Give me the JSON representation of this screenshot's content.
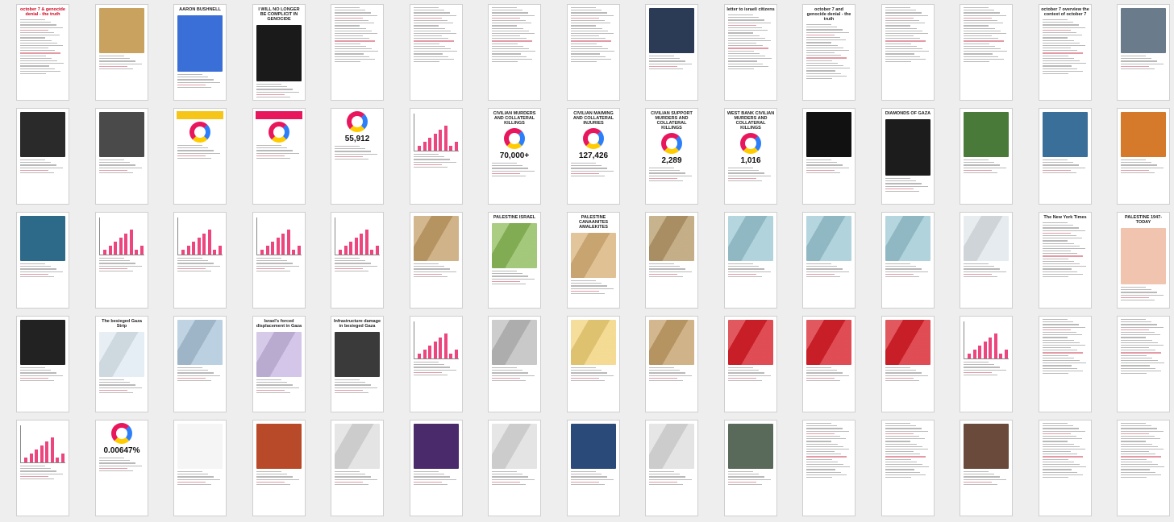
{
  "pages": [
    {
      "row": 0,
      "col": 0,
      "title": "october 7 & genocide denial - the truth",
      "title_color": "red",
      "kind": "text"
    },
    {
      "row": 0,
      "col": 1,
      "kind": "photo",
      "bg": "#c9a25f"
    },
    {
      "row": 0,
      "col": 2,
      "title": "AARON BUSHNELL",
      "kind": "poster",
      "bg": "#3a6fd8"
    },
    {
      "row": 0,
      "col": 3,
      "title": "I WILL NO LONGER BE COMPLICIT IN GENOCIDE",
      "kind": "poster",
      "bg": "#1a1a1a"
    },
    {
      "row": 0,
      "col": 4,
      "kind": "text"
    },
    {
      "row": 0,
      "col": 5,
      "kind": "text"
    },
    {
      "row": 0,
      "col": 6,
      "kind": "text"
    },
    {
      "row": 0,
      "col": 7,
      "kind": "text"
    },
    {
      "row": 0,
      "col": 8,
      "kind": "photo",
      "bg": "#2b3a55"
    },
    {
      "row": 0,
      "col": 9,
      "title": "letter to israeli citizens",
      "kind": "text"
    },
    {
      "row": 0,
      "col": 10,
      "title": "october 7 and genocide denial - the truth",
      "kind": "text"
    },
    {
      "row": 0,
      "col": 11,
      "kind": "text"
    },
    {
      "row": 0,
      "col": 12,
      "kind": "text"
    },
    {
      "row": 0,
      "col": 13,
      "title": "october 7 overview the context of october 7",
      "kind": "text"
    },
    {
      "row": 0,
      "col": 14,
      "kind": "photo",
      "bg": "#6a7b8c"
    },
    {
      "row": 1,
      "col": 0,
      "kind": "photo",
      "bg": "#2a2a2a"
    },
    {
      "row": 1,
      "col": 1,
      "kind": "photo",
      "bg": "#4a4a4a"
    },
    {
      "row": 1,
      "col": 2,
      "kind": "stats",
      "bg": "#f5c518"
    },
    {
      "row": 1,
      "col": 3,
      "kind": "stats",
      "bg": "#e8175d"
    },
    {
      "row": 1,
      "col": 4,
      "kind": "stats",
      "label": "55,912"
    },
    {
      "row": 1,
      "col": 5,
      "kind": "chart"
    },
    {
      "row": 1,
      "col": 6,
      "title": "CIVILIAN MURDERS AND COLLATERAL KILLINGS",
      "label": "70,000+",
      "kind": "stats"
    },
    {
      "row": 1,
      "col": 7,
      "title": "CIVILIAN MAIMING AND COLLATERAL INJURIES",
      "label": "127,426",
      "kind": "stats"
    },
    {
      "row": 1,
      "col": 8,
      "title": "CIVILIAN SUPPORT MURDERS AND COLLATERAL KILLINGS",
      "label": "2,289",
      "kind": "stats"
    },
    {
      "row": 1,
      "col": 9,
      "title": "WEST BANK CIVILIAN MURDERS AND COLLATERAL KILLINGS",
      "label": "1,016",
      "kind": "stats"
    },
    {
      "row": 1,
      "col": 10,
      "kind": "photo",
      "bg": "#111111"
    },
    {
      "row": 1,
      "col": 11,
      "title": "DIAMONDS OF GAZA",
      "kind": "poster",
      "bg": "#1c1c1c"
    },
    {
      "row": 1,
      "col": 12,
      "kind": "photo",
      "bg": "#4a7a3a"
    },
    {
      "row": 1,
      "col": 13,
      "kind": "photo",
      "bg": "#3a6f9a"
    },
    {
      "row": 1,
      "col": 14,
      "kind": "photo",
      "bg": "#d47a2a"
    },
    {
      "row": 2,
      "col": 0,
      "kind": "photo",
      "bg": "#2d6a8a"
    },
    {
      "row": 2,
      "col": 1,
      "kind": "chart"
    },
    {
      "row": 2,
      "col": 2,
      "kind": "chart"
    },
    {
      "row": 2,
      "col": 3,
      "kind": "chart"
    },
    {
      "row": 2,
      "col": 4,
      "kind": "chart"
    },
    {
      "row": 2,
      "col": 5,
      "kind": "map",
      "bg": "#c4a06a"
    },
    {
      "row": 2,
      "col": 6,
      "title": "PALESTINE ISRAEL",
      "kind": "map",
      "bg": "#8dbb5a"
    },
    {
      "row": 2,
      "col": 7,
      "title": "PALESTINE CANAANITES AMALEKITES",
      "kind": "map",
      "bg": "#d8b27a"
    },
    {
      "row": 2,
      "col": 8,
      "kind": "map",
      "bg": "#b69a6a"
    },
    {
      "row": 2,
      "col": 9,
      "kind": "map",
      "bg": "#9cc8d4"
    },
    {
      "row": 2,
      "col": 10,
      "kind": "map",
      "bg": "#9cc8d4"
    },
    {
      "row": 2,
      "col": 11,
      "kind": "map",
      "bg": "#9cc8d4"
    },
    {
      "row": 2,
      "col": 12,
      "kind": "map",
      "bg": "#dfe6ea"
    },
    {
      "row": 2,
      "col": 13,
      "title": "The New York Times",
      "kind": "text"
    },
    {
      "row": 2,
      "col": 14,
      "title": "PALESTINE 1947-TODAY",
      "kind": "poster",
      "bg": "#f1c4b0"
    },
    {
      "row": 3,
      "col": 0,
      "kind": "photo",
      "bg": "#222222"
    },
    {
      "row": 3,
      "col": 1,
      "title": "The besieged Gaza Strip",
      "kind": "map",
      "bg": "#dfeaf2"
    },
    {
      "row": 3,
      "col": 2,
      "kind": "map",
      "bg": "#aac4d8"
    },
    {
      "row": 3,
      "col": 3,
      "title": "Israel's forced displacement in Gaza",
      "kind": "map",
      "bg": "#c9b8e2"
    },
    {
      "row": 3,
      "col": 4,
      "title": "Infrastructure damage in besieged Gaza",
      "kind": "photo",
      "bg": "#3a3a3a"
    },
    {
      "row": 3,
      "col": 5,
      "kind": "chart"
    },
    {
      "row": 3,
      "col": 6,
      "kind": "map",
      "bg": "#bcbcbc"
    },
    {
      "row": 3,
      "col": 7,
      "kind": "map",
      "bg": "#f2d27a"
    },
    {
      "row": 3,
      "col": 8,
      "kind": "map",
      "bg": "#c4a06a"
    },
    {
      "row": 3,
      "col": 9,
      "kind": "map",
      "bg": "#d8202a"
    },
    {
      "row": 3,
      "col": 10,
      "kind": "map",
      "bg": "#d8202a"
    },
    {
      "row": 3,
      "col": 11,
      "kind": "map",
      "bg": "#d8202a"
    },
    {
      "row": 3,
      "col": 12,
      "kind": "chart"
    },
    {
      "row": 3,
      "col": 13,
      "kind": "text"
    },
    {
      "row": 3,
      "col": 14,
      "kind": "text"
    },
    {
      "row": 4,
      "col": 0,
      "kind": "chart"
    },
    {
      "row": 4,
      "col": 1,
      "label": "0.00647%",
      "kind": "stats"
    },
    {
      "row": 4,
      "col": 2,
      "kind": "photo",
      "bg": "#f5f5f5"
    },
    {
      "row": 4,
      "col": 3,
      "kind": "photo",
      "bg": "#b84a2a"
    },
    {
      "row": 4,
      "col": 4,
      "kind": "map",
      "bg": "#dddddd"
    },
    {
      "row": 4,
      "col": 5,
      "kind": "photo",
      "bg": "#4a2a6a"
    },
    {
      "row": 4,
      "col": 6,
      "kind": "map",
      "bg": "#dddddd"
    },
    {
      "row": 4,
      "col": 7,
      "kind": "photo",
      "bg": "#2a4a7a"
    },
    {
      "row": 4,
      "col": 8,
      "kind": "map",
      "bg": "#dddddd"
    },
    {
      "row": 4,
      "col": 9,
      "kind": "photo",
      "bg": "#5a6a5a"
    },
    {
      "row": 4,
      "col": 10,
      "kind": "text"
    },
    {
      "row": 4,
      "col": 11,
      "kind": "text"
    },
    {
      "row": 4,
      "col": 12,
      "kind": "photo",
      "bg": "#6a4a3a"
    },
    {
      "row": 4,
      "col": 13,
      "kind": "text"
    },
    {
      "row": 4,
      "col": 14,
      "kind": "text"
    }
  ]
}
